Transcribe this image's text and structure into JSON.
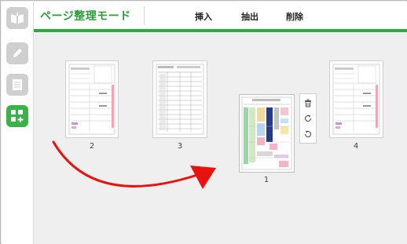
{
  "header": {
    "title": "ページ整理モード",
    "menu": {
      "insert": "挿入",
      "extract": "抽出",
      "delete": "削除"
    }
  },
  "sidebar": {
    "items": [
      {
        "icon": "open-book-icon",
        "active": false
      },
      {
        "icon": "pencil-icon",
        "active": false
      },
      {
        "icon": "document-icon",
        "active": false
      },
      {
        "icon": "grid-plus-icon",
        "active": true
      }
    ]
  },
  "pages": [
    {
      "label": "2",
      "kind": "form-a"
    },
    {
      "label": "3",
      "kind": "form-b"
    },
    {
      "label": "1",
      "kind": "form-color",
      "selected": true
    },
    {
      "label": "4",
      "kind": "form-a"
    }
  ],
  "page_tools": {
    "icons": [
      "trash-icon",
      "rotate-right-icon",
      "rotate-left-icon"
    ]
  },
  "annotation": {
    "arrow_color": "#e8120f"
  },
  "colors": {
    "accent": "#2fa83d"
  }
}
